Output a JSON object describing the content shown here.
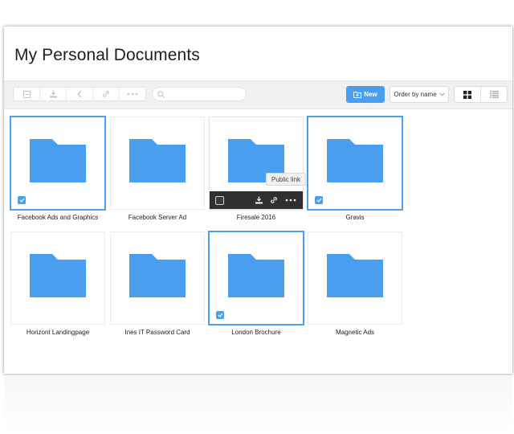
{
  "page": {
    "title": "My Personal Documents"
  },
  "toolbar": {
    "search_placeholder": "",
    "new_label": "New",
    "order_label": "Order by name"
  },
  "tooltip": {
    "label": "Public link"
  },
  "colors": {
    "accent": "#4a9ef0",
    "folder": "#4a9ef0",
    "hover_bar": "#2f2f2f"
  },
  "icons": [
    "info-icon",
    "download-icon",
    "share-icon",
    "link-icon",
    "more-icon",
    "search-icon",
    "add-folder-icon",
    "chevron-down-icon",
    "grid-view-icon",
    "list-view-icon",
    "folder-icon",
    "check-icon"
  ],
  "items": [
    {
      "label": "Facebook Ads and Graphics",
      "selected": true
    },
    {
      "label": "Facebook Server Ad",
      "selected": false
    },
    {
      "label": "Firesale 2016",
      "selected": false,
      "hovered": true
    },
    {
      "label": "Gravis",
      "selected": true
    },
    {
      "label": "Horizont Landingpage",
      "selected": false
    },
    {
      "label": "Ines IT Password Card",
      "selected": false
    },
    {
      "label": "London Brochure",
      "selected": true
    },
    {
      "label": "Magnetic Ads",
      "selected": false
    }
  ]
}
